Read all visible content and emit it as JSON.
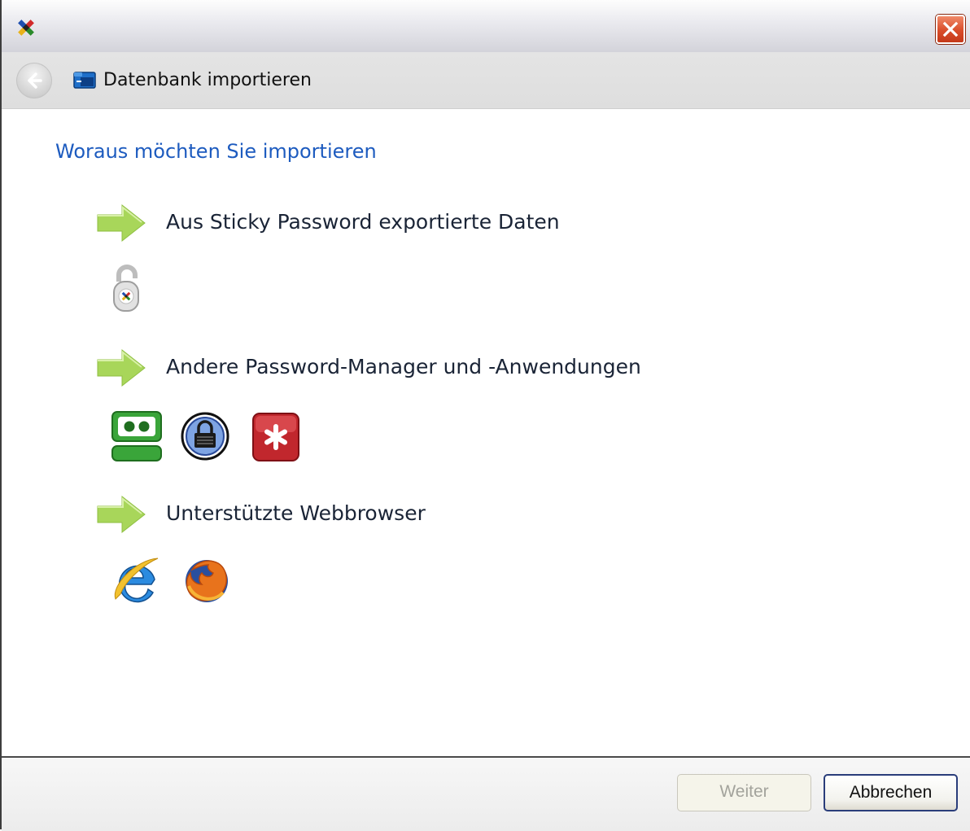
{
  "window": {
    "nav_title": "Datenbank importieren"
  },
  "main": {
    "question": "Woraus möchten Sie importieren",
    "options": [
      {
        "label": "Aus Sticky Password exportierte Daten",
        "icons": [
          "sticky-password-lock-icon"
        ]
      },
      {
        "label": "Andere Password-Manager und -Anwendungen",
        "icons": [
          "roboform-icon",
          "keepass-icon",
          "lastpass-icon"
        ]
      },
      {
        "label": "Unterstützte Webbrowser",
        "icons": [
          "internet-explorer-icon",
          "firefox-icon"
        ]
      }
    ]
  },
  "footer": {
    "next_label": "Weiter",
    "next_enabled": false,
    "cancel_label": "Abbrechen"
  },
  "colors": {
    "question_text": "#1d5bbf",
    "arrow_green": "#a8d65a",
    "close_button": "#d94d2a"
  }
}
